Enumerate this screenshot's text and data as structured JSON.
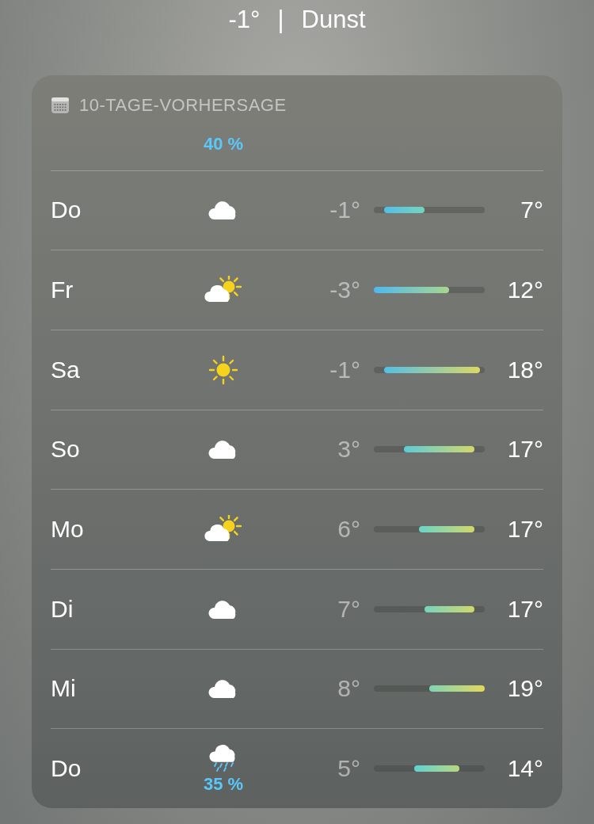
{
  "current": {
    "temperature": "-1°",
    "separator": "|",
    "condition": "Dunst"
  },
  "forecast": {
    "title": "10-TAGE-VORHERSAGE",
    "partial_row": {
      "precipitation": "40 %"
    },
    "days": [
      {
        "day": "Do",
        "kind": "cloud",
        "low": "-1°",
        "high": "7°"
      },
      {
        "day": "Fr",
        "kind": "partly-sunny",
        "low": "-3°",
        "high": "12°"
      },
      {
        "day": "Sa",
        "kind": "sun",
        "low": "-1°",
        "high": "18°"
      },
      {
        "day": "So",
        "kind": "cloud",
        "low": "3°",
        "high": "17°"
      },
      {
        "day": "Mo",
        "kind": "partly-sunny",
        "low": "6°",
        "high": "17°"
      },
      {
        "day": "Di",
        "kind": "cloud",
        "low": "7°",
        "high": "17°"
      },
      {
        "day": "Mi",
        "kind": "cloud",
        "low": "8°",
        "high": "19°"
      },
      {
        "day": "Do",
        "kind": "rain",
        "low": "5°",
        "high": "14°",
        "precipitation": "35 %"
      }
    ]
  }
}
